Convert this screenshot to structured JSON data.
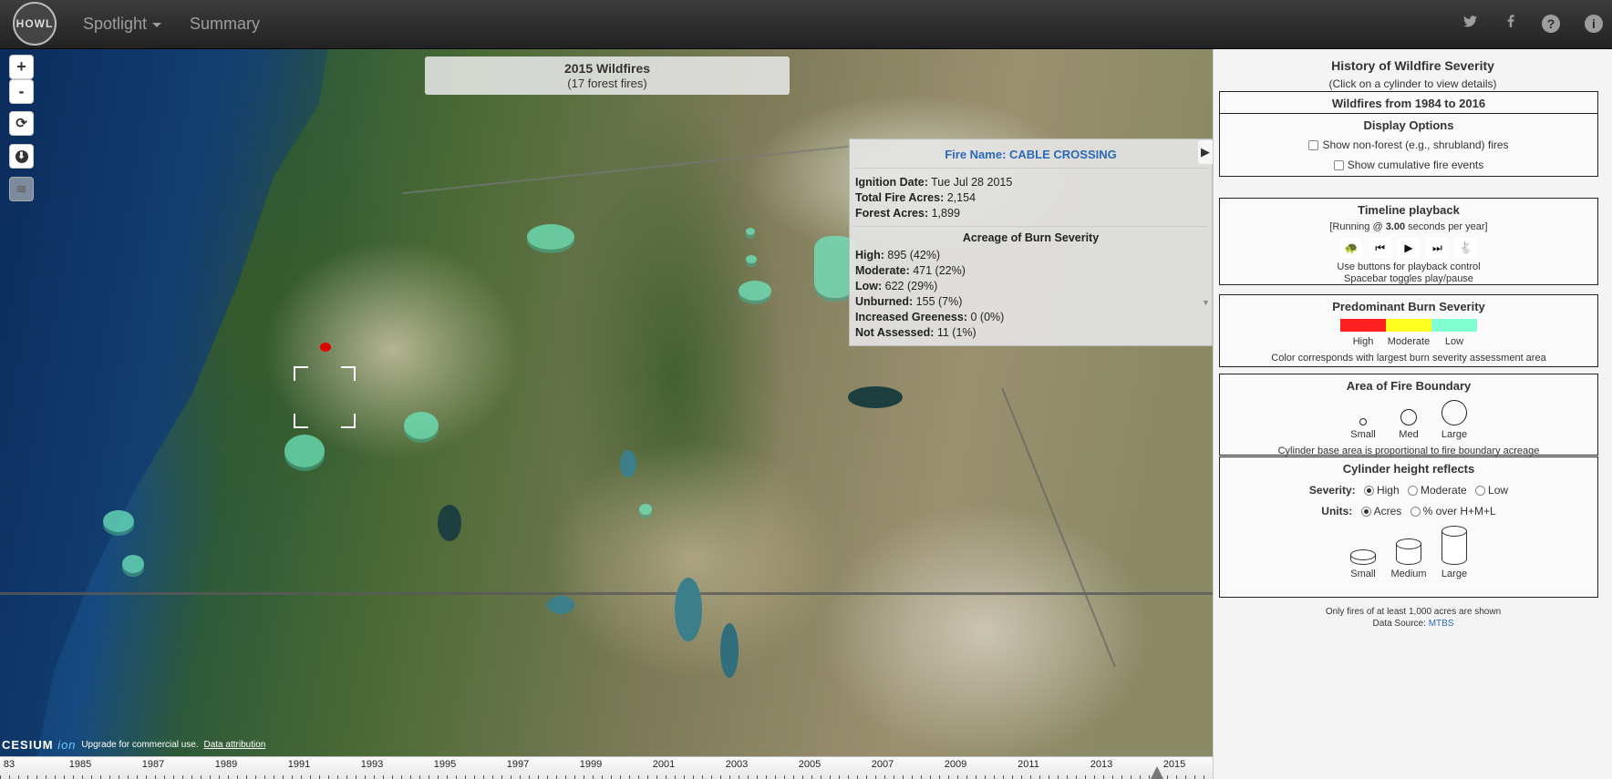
{
  "nav": {
    "logo": "HOWL",
    "spotlight": "Spotlight",
    "summary": "Summary",
    "icons": [
      "twitter-icon",
      "facebook-icon",
      "help-icon",
      "info-icon"
    ]
  },
  "map": {
    "controls": {
      "zoom_in": "+",
      "zoom_out": "-"
    },
    "year_title": "2015 Wildfires",
    "year_sub": "(17 forest fires)",
    "credits": {
      "logo_main": "CESIUM",
      "logo_ion": "ion",
      "upgrade": "Upgrade for commercial use.",
      "attribution": "Data attribution"
    }
  },
  "popup": {
    "title": "Fire Name: CABLE CROSSING",
    "ignition_label": "Ignition Date:",
    "ignition_value": "Tue Jul 28 2015",
    "total_label": "Total Fire Acres:",
    "total_value": "2,154",
    "forest_label": "Forest Acres:",
    "forest_value": "1,899",
    "severity_title": "Acreage of Burn Severity",
    "rows": [
      {
        "label": "High:",
        "value": "895 (42%)"
      },
      {
        "label": "Moderate:",
        "value": "471 (22%)"
      },
      {
        "label": "Low:",
        "value": "622 (29%)"
      },
      {
        "label": "Unburned:",
        "value": "155 (7%)"
      },
      {
        "label": "Increased Greeness:",
        "value": "0 (0%)"
      },
      {
        "label": "Not Assessed:",
        "value": "11 (1%)"
      }
    ]
  },
  "timeline": {
    "labels": [
      "83",
      "1985",
      "1987",
      "1989",
      "1991",
      "1993",
      "1995",
      "1997",
      "1999",
      "2001",
      "2003",
      "2005",
      "2007",
      "2009",
      "2011",
      "2013",
      "2015"
    ]
  },
  "panel": {
    "title": "History of Wildfire Severity",
    "subtitle": "(Click on a cylinder to view details)",
    "range": "Wildfires from 1984 to 2016",
    "display_options": {
      "title": "Display Options",
      "nonforest": "Show non-forest (e.g., shrubland) fires",
      "cumulative": "Show cumulative fire events"
    },
    "playback": {
      "title": "Timeline playback",
      "running_pre": "[Running @ ",
      "running_value": "3.00",
      "running_post": " seconds per year]",
      "help1": "Use buttons for playback control",
      "help2": "Spacebar toggles play/pause"
    },
    "severity": {
      "title": "Predominant Burn Severity",
      "labels": [
        "High",
        "Moderate",
        "Low"
      ],
      "colors": [
        "#ff2020",
        "#ffff20",
        "#80ffd0"
      ],
      "note": "Color corresponds with largest burn severity assessment area"
    },
    "area": {
      "title": "Area of Fire Boundary",
      "labels": [
        "Small",
        "Med",
        "Large"
      ],
      "note": "Cylinder base area is proportional to fire boundary acreage"
    },
    "height": {
      "title": "Cylinder height reflects",
      "severity_label": "Severity:",
      "severity_options": [
        "High",
        "Moderate",
        "Low"
      ],
      "units_label": "Units:",
      "units_options": [
        "Acres",
        "% over H+M+L"
      ],
      "sizes": [
        "Small",
        "Medium",
        "Large"
      ]
    },
    "footer": {
      "note": "Only fires of at least 1,000 acres are shown",
      "source_label": "Data Source: ",
      "source_link": "MTBS"
    }
  }
}
